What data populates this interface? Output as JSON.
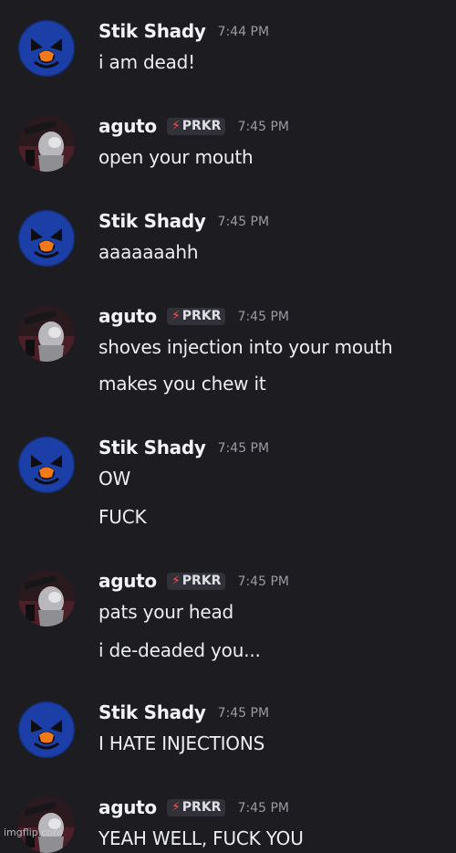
{
  "users": {
    "stik": {
      "name": "Stik Shady",
      "avatar_icon": "blue-masked-avatar-icon",
      "avatar_color": "#1b3fa6"
    },
    "aguto": {
      "name": "aguto",
      "avatar_icon": "grey-character-avatar-icon",
      "tag": "PRKR",
      "tag_icon": "lightning-bolt-icon",
      "tag_color": "#f0524f"
    }
  },
  "messages": [
    {
      "author": "Stik Shady",
      "time": "7:44 PM",
      "lines": [
        "i am dead!"
      ]
    },
    {
      "author": "aguto",
      "tag": "PRKR",
      "time": "7:45 PM",
      "lines": [
        "open your mouth"
      ]
    },
    {
      "author": "Stik Shady",
      "time": "7:45 PM",
      "lines": [
        "aaaaaaahh"
      ]
    },
    {
      "author": "aguto",
      "tag": "PRKR",
      "time": "7:45 PM",
      "lines": [
        "shoves injection into your mouth",
        "makes you chew it"
      ]
    },
    {
      "author": "Stik Shady",
      "time": "7:45 PM",
      "lines": [
        "OW",
        "FUCK"
      ]
    },
    {
      "author": "aguto",
      "tag": "PRKR",
      "time": "7:45 PM",
      "lines": [
        "pats your head",
        "i de-deaded you..."
      ]
    },
    {
      "author": "Stik Shady",
      "time": "7:45 PM",
      "lines": [
        "I HATE INJECTIONS"
      ]
    },
    {
      "author": "aguto",
      "tag": "PRKR",
      "time": "7:45 PM",
      "lines": [
        "YEAH WELL, FUCK YOU"
      ]
    }
  ],
  "watermark": "imgflip.com"
}
